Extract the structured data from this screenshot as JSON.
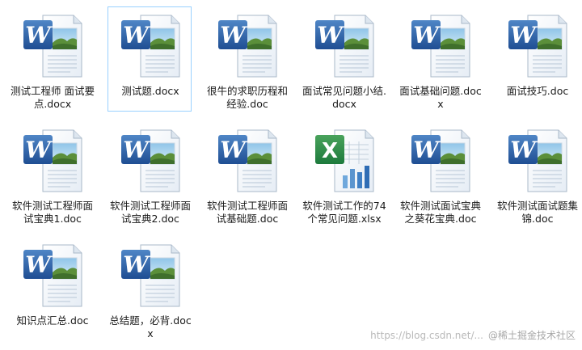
{
  "files": [
    {
      "name": "测试工程师 面试要点.docx",
      "type": "word",
      "selected": false
    },
    {
      "name": "测试题.docx",
      "type": "word",
      "selected": true
    },
    {
      "name": "很牛的求职历程和经验.doc",
      "type": "word",
      "selected": false
    },
    {
      "name": "面试常见问题小结.docx",
      "type": "word",
      "selected": false
    },
    {
      "name": "面试基础问题.docx",
      "type": "word",
      "selected": false
    },
    {
      "name": "面试技巧.doc",
      "type": "word",
      "selected": false
    },
    {
      "name": "软件测试工程师面试宝典1.doc",
      "type": "word",
      "selected": false
    },
    {
      "name": "软件测试工程师面试宝典2.doc",
      "type": "word",
      "selected": false
    },
    {
      "name": "软件测试工程师面试基础题.doc",
      "type": "word",
      "selected": false
    },
    {
      "name": "软件测试工作的74个常见问题.xlsx",
      "type": "excel",
      "selected": false
    },
    {
      "name": "软件测试面试宝典之葵花宝典.doc",
      "type": "word",
      "selected": false
    },
    {
      "name": "软件测试面试题集锦.doc",
      "type": "word",
      "selected": false
    },
    {
      "name": "知识点汇总.doc",
      "type": "word",
      "selected": false
    },
    {
      "name": "总结题，必背.docx",
      "type": "word",
      "selected": false
    }
  ],
  "watermark": {
    "url": "https://blog.csdn.net/...",
    "brand": "@稀土掘金技术社区"
  },
  "colors": {
    "selection_border": "#99d1ff",
    "word_blue": "#2a5699",
    "excel_green": "#1d7a3c"
  }
}
